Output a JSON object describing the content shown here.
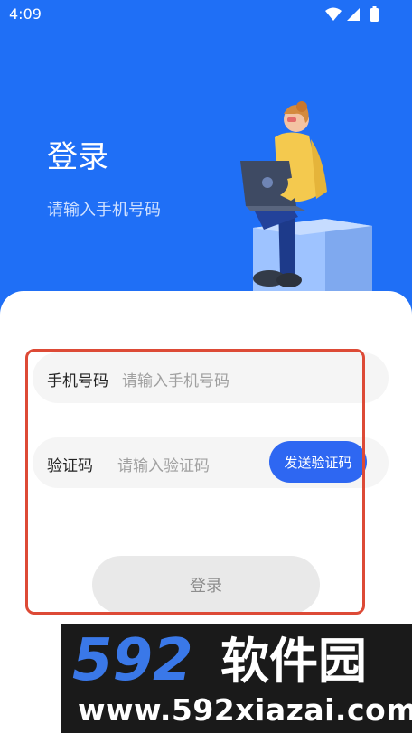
{
  "status_bar": {
    "time": "4:09"
  },
  "header": {
    "title": "登录",
    "subtitle": "请输入手机号码"
  },
  "form": {
    "phone_label": "手机号码",
    "phone_placeholder": "请输入手机号码",
    "code_label": "验证码",
    "code_placeholder": "请输入验证码",
    "send_code_button": "发送验证码",
    "login_button": "登录"
  },
  "watermark": {
    "brand_number": "592",
    "brand_text": "软件园",
    "url": "www.592xiazai.com"
  },
  "colors": {
    "primary_blue": "#1f6ff6",
    "button_blue": "#2e67f2",
    "highlight_red": "#dd4a36"
  }
}
